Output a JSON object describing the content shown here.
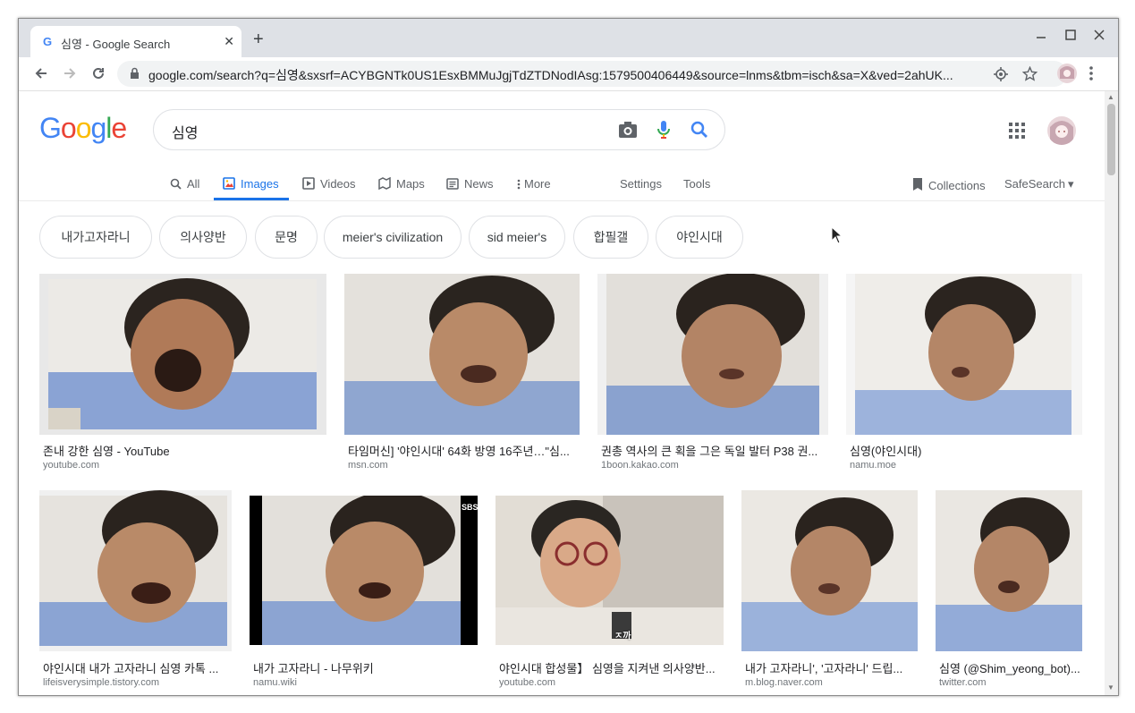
{
  "browser": {
    "tab_title": "심영 - Google Search",
    "new_tab": "+",
    "url": "google.com/search?q=심영&sxsrf=ACYBGNTk0US1EsxBMMuJgjTdZTDNodIAsg:1579500406449&source=lnms&tbm=isch&sa=X&ved=2ahUK..."
  },
  "google": {
    "logo": "Google",
    "query": "심영",
    "tabs": {
      "all": "All",
      "images": "Images",
      "videos": "Videos",
      "maps": "Maps",
      "news": "News",
      "more": "More",
      "settings": "Settings",
      "tools": "Tools"
    },
    "collections": "Collections",
    "safesearch": "SafeSearch",
    "chips": [
      "내가고자라니",
      "의사양반",
      "문명",
      "meier's civilization",
      "sid meier's",
      "합필갤",
      "야인시대"
    ],
    "results": [
      {
        "caption": "존내 강한 심영 - YouTube",
        "source": "youtube.com"
      },
      {
        "caption": "타임머신] '야인시대' 64화 방영 16주년…\"심...",
        "source": "msn.com"
      },
      {
        "caption": "권총 역사의 큰 획을 그은 독일 발터 P38 권...",
        "source": "1boon.kakao.com"
      },
      {
        "caption": "심영(야인시대)",
        "source": "namu.moe"
      },
      {
        "caption": "야인시대 내가 고자라니 심영 카톡 ...",
        "source": "lifeisverysimple.tistory.com"
      },
      {
        "caption": "내가 고자라니 - 나무위키",
        "source": "namu.wiki"
      },
      {
        "caption": "야인시대 합성물】 심영을 지켜낸 의사양반...",
        "source": "youtube.com"
      },
      {
        "caption": "내가 고자라니', '고자라니' 드립...",
        "source": "m.blog.naver.com"
      },
      {
        "caption": "심영 (@Shim_yeong_bot)...",
        "source": "twitter.com"
      }
    ],
    "overlays": {
      "sbs": "SBS",
      "subtitle": "ㅈ까"
    }
  },
  "colors": {
    "google_blue": "#4285f4",
    "google_red": "#ea4335",
    "google_yellow": "#fbbc05",
    "google_green": "#34a853",
    "active_tab": "#1a73e8"
  }
}
